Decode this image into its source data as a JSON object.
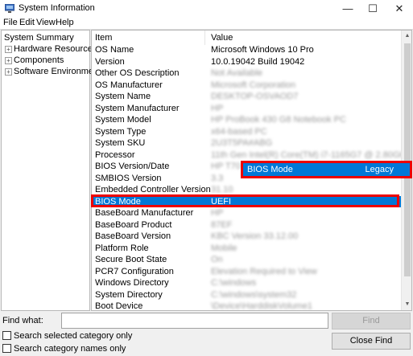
{
  "window": {
    "title": "System Information",
    "controls": {
      "minimize": "—",
      "maximize": "☐",
      "close": "✕"
    }
  },
  "menu": [
    "File",
    "Edit",
    "View",
    "Help"
  ],
  "tree": {
    "root": "System Summary",
    "children": [
      {
        "label": "Hardware Resources",
        "expander": "+"
      },
      {
        "label": "Components",
        "expander": "+"
      },
      {
        "label": "Software Environment",
        "expander": "+"
      }
    ]
  },
  "list": {
    "columns": [
      "Item",
      "Value"
    ],
    "rows": [
      {
        "item": "OS Name",
        "value": "Microsoft Windows 10 Pro"
      },
      {
        "item": "Version",
        "value": "10.0.19042 Build 19042"
      },
      {
        "item": "Other OS Description",
        "value": "Not Available",
        "blurred": true
      },
      {
        "item": "OS Manufacturer",
        "value": "Microsoft Corporation",
        "blurred": true
      },
      {
        "item": "System Name",
        "value": "DESKTOP-OSVAOD7",
        "blurred": true
      },
      {
        "item": "System Manufacturer",
        "value": "HP",
        "blurred": true
      },
      {
        "item": "System Model",
        "value": "HP ProBook 430 G8 Notebook PC",
        "blurred": true
      },
      {
        "item": "System Type",
        "value": "x64-based PC",
        "blurred": true
      },
      {
        "item": "System SKU",
        "value": "2U3T5PA#ABG",
        "blurred": true
      },
      {
        "item": "Processor",
        "value": "11th Gen Intel(R) Core(TM) i7-1165G7 @ 2.80GHz, 28...",
        "blurred": true
      },
      {
        "item": "BIOS Version/Date",
        "value": "HP T70 Ver. 01.04.02",
        "blurred": true
      },
      {
        "item": "SMBIOS Version",
        "value": "3.3",
        "blurred": true
      },
      {
        "item": "Embedded Controller Version",
        "value": "31.10",
        "blurred": true
      },
      {
        "item": "BIOS Mode",
        "value": "UEFI",
        "selected": true
      },
      {
        "item": "BaseBoard Manufacturer",
        "value": "HP",
        "blurred": true
      },
      {
        "item": "BaseBoard Product",
        "value": "87EF",
        "blurred": true
      },
      {
        "item": "BaseBoard Version",
        "value": "KBC Version 33.12.00",
        "blurred": true
      },
      {
        "item": "Platform Role",
        "value": "Mobile",
        "blurred": true
      },
      {
        "item": "Secure Boot State",
        "value": "On",
        "blurred": true
      },
      {
        "item": "PCR7 Configuration",
        "value": "Elevation Required to View",
        "blurred": true
      },
      {
        "item": "Windows Directory",
        "value": "C:\\windows",
        "blurred": true
      },
      {
        "item": "System Directory",
        "value": "C:\\windows\\system32",
        "blurred": true
      },
      {
        "item": "Boot Device",
        "value": "\\Device\\HarddiskVolume1",
        "blurred": true
      }
    ]
  },
  "callout": {
    "item": "BIOS Mode",
    "value": "Legacy"
  },
  "find": {
    "label": "Find what:",
    "value": "",
    "find_button": "Find",
    "close_find_button": "Close Find",
    "search_selected_label": "Search selected category only",
    "search_names_label": "Search category names only"
  },
  "colors": {
    "selection": "#0078d7",
    "annotation": "#e00000"
  }
}
